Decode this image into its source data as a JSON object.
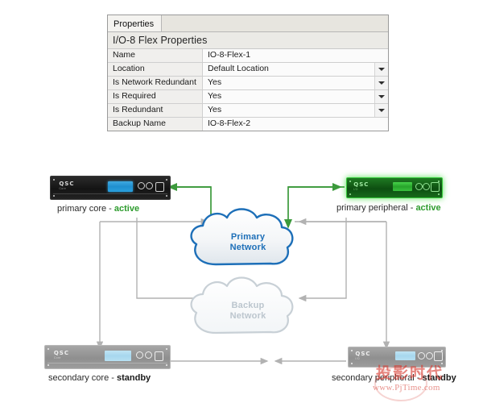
{
  "panel": {
    "tab_label": "Properties",
    "title": "I/O-8 Flex Properties",
    "rows": [
      {
        "label": "Name",
        "value": "IO-8-Flex-1",
        "dropdown": false
      },
      {
        "label": "Location",
        "value": "Default Location",
        "dropdown": true
      },
      {
        "label": "Is Network Redundant",
        "value": "Yes",
        "dropdown": true
      },
      {
        "label": "Is Required",
        "value": "Yes",
        "dropdown": true
      },
      {
        "label": "Is Redundant",
        "value": "Yes",
        "dropdown": true
      },
      {
        "label": "Backup Name",
        "value": "IO-8-Flex-2",
        "dropdown": false
      }
    ]
  },
  "diagram": {
    "devices": [
      {
        "id": "primary-core",
        "brand": "QSC",
        "model": "Core",
        "role": "primary core",
        "separator": " - ",
        "state": "active"
      },
      {
        "id": "primary-peripheral",
        "brand": "QSC",
        "model": "I/O",
        "role": "primary peripheral",
        "separator": " - ",
        "state": "active"
      },
      {
        "id": "secondary-core",
        "brand": "QSC",
        "model": "Core",
        "role": "secondary core",
        "separator": " - ",
        "state": "standby"
      },
      {
        "id": "secondary-peripheral",
        "brand": "QSC",
        "model": "I/O",
        "role": "secondary peripheral",
        "separator": " - ",
        "state": "standby"
      }
    ],
    "clouds": [
      {
        "id": "primary-network",
        "line1": "Primary",
        "line2": "Network"
      },
      {
        "id": "backup-network",
        "line1": "Backup",
        "line2": "Network"
      }
    ],
    "colors": {
      "active_green": "#2e9c2e",
      "link_green": "#3c9a3c",
      "link_gray": "#b2b2b2",
      "primary_cloud_stroke": "#1d6fb8",
      "backup_cloud_stroke": "#c8d0d6"
    }
  },
  "watermark": {
    "cn_text": "投影时代",
    "url": "www.PjTime.com"
  }
}
